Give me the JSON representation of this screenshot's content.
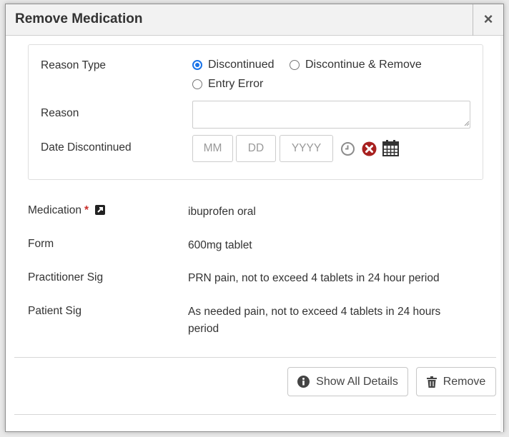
{
  "modal": {
    "title": "Remove Medication",
    "close_label": "×"
  },
  "reason_panel": {
    "reason_type_label": "Reason Type",
    "reason_options": [
      "Discontinued",
      "Discontinue & Remove",
      "Entry Error"
    ],
    "selected_reason": "Discontinued",
    "reason_label": "Reason",
    "reason_value": "",
    "date_label": "Date Discontinued",
    "date_placeholders": {
      "month": "MM",
      "day": "DD",
      "year": "YYYY"
    }
  },
  "details": {
    "medication_label": "Medication",
    "required_marker": "*",
    "medication_value": "ibuprofen oral",
    "form_label": "Form",
    "form_value": "600mg tablet",
    "practitioner_sig_label": "Practitioner Sig",
    "practitioner_sig_value": "PRN pain, not to exceed 4 tablets in 24 hour period",
    "patient_sig_label": "Patient Sig",
    "patient_sig_value": "As needed pain, not to exceed 4 tablets in 24 hours period"
  },
  "footer": {
    "show_all_details_label": "Show All Details",
    "remove_label": "Remove"
  },
  "icons": {
    "clock": "clock-icon",
    "clear": "clear-date-icon",
    "calendar": "calendar-icon",
    "info": "info-icon",
    "trash": "trash-icon",
    "external_link": "external-link-icon"
  },
  "colors": {
    "radio_accent": "#1a73e8",
    "clear_icon": "#a82120",
    "required": "#c9302c"
  }
}
